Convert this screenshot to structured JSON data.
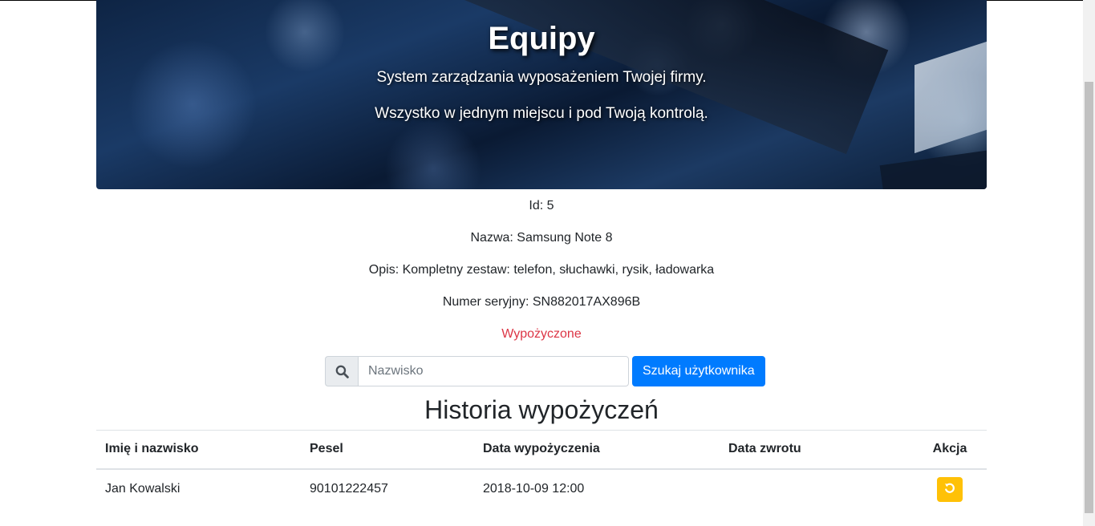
{
  "hero": {
    "title": "Equipy",
    "subtitle1": "System zarządzania wyposażeniem Twojej firmy.",
    "subtitle2": "Wszystko w jednym miejscu i pod Twoją kontrolą."
  },
  "equipment": {
    "id": "Id: 5",
    "name": "Nazwa: Samsung Note 8",
    "description": "Opis: Kompletny zestaw: telefon, słuchawki, rysik, ładowarka",
    "serial": "Numer seryjny: SN882017AX896B",
    "status": "Wypożyczone"
  },
  "search": {
    "placeholder": "Nazwisko",
    "value": "",
    "button_label": "Szukaj użytkownika",
    "icon": "search-icon"
  },
  "history": {
    "title": "Historia wypożyczeń",
    "columns": [
      "Imię i nazwisko",
      "Pesel",
      "Data wypożyczenia",
      "Data zwrotu",
      "Akcja"
    ],
    "rows": [
      {
        "name": "Jan Kowalski",
        "pesel": "90101222457",
        "date_borrowed": "2018-10-09 12:00",
        "date_returned": "",
        "action_icon": "undo-icon"
      }
    ]
  },
  "colors": {
    "primary": "#007bff",
    "danger": "#dc3545",
    "warning": "#ffc107"
  }
}
